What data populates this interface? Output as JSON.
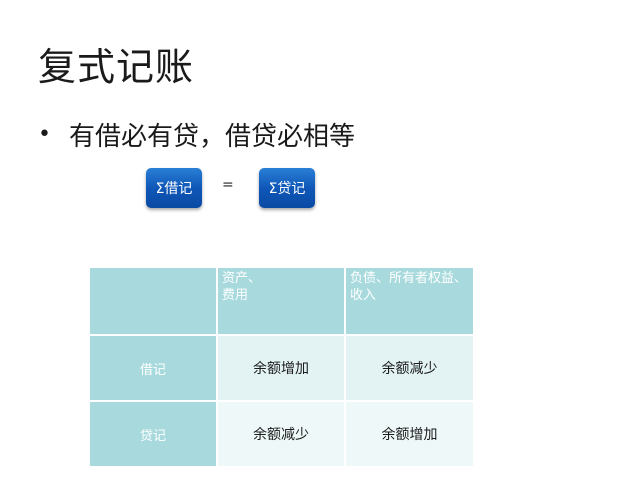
{
  "slide": {
    "title": "复式记账",
    "bullet": "有借必有贷，借贷必相等"
  },
  "equation": {
    "left_label": "Σ借记",
    "sign": "=",
    "right_label": "Σ贷记",
    "box_color": "#0f57b8"
  },
  "table": {
    "header_color": "#a8dadd",
    "headers": [
      "",
      "资产、\n费用",
      "负债、所有者权益、收入"
    ],
    "rows": [
      {
        "label": "借记",
        "cells": [
          "余额增加",
          "余额减少"
        ]
      },
      {
        "label": "贷记",
        "cells": [
          "余额减少",
          "余额增加"
        ]
      }
    ]
  }
}
